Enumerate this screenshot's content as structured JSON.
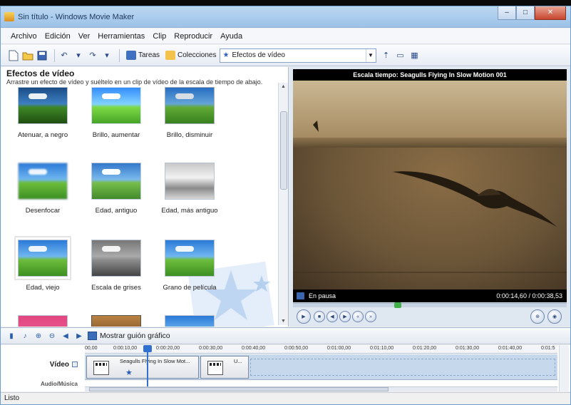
{
  "window": {
    "title": "Sin título - Windows Movie Maker",
    "minimize": "–",
    "maximize": "□",
    "close": "✕"
  },
  "menu": [
    "Archivo",
    "Edición",
    "Ver",
    "Herramientas",
    "Clip",
    "Reproducir",
    "Ayuda"
  ],
  "toolbar": {
    "tasks_label": "Tareas",
    "collections_label": "Colecciones",
    "location_value": "Efectos de vídeo"
  },
  "effects_pane": {
    "title": "Efectos de vídeo",
    "subtitle": "Arrastre un efecto de vídeo y suéltelo en un clip de vídeo de la escala de tiempo de abajo.",
    "items": [
      {
        "label": "Atenuar, a negro"
      },
      {
        "label": "Brillo, aumentar"
      },
      {
        "label": "Brillo, disminuir"
      },
      {
        "label": "Desenfocar"
      },
      {
        "label": "Edad, antiguo"
      },
      {
        "label": "Edad, más antiguo"
      },
      {
        "label": "Edad, viejo"
      },
      {
        "label": "Escala de grises"
      },
      {
        "label": "Grano de película"
      }
    ]
  },
  "preview": {
    "header": "Escala tiempo: Seagulls Flying In Slow Motion 001",
    "status": "En pausa",
    "time": "0:00:14,60 / 0:00:38,53",
    "seek_fraction": 0.38
  },
  "timeline_toolbar": {
    "storyboard_label": "Mostrar guión gráfico"
  },
  "timeline": {
    "ruler_ticks": [
      "00,00",
      "0:00:10,00",
      "0:00:20,00",
      "0:00:30,00",
      "0:00:40,00",
      "0:00:50,00",
      "0:01:00,00",
      "0:01:10,00",
      "0:01:20,00",
      "0:01:30,00",
      "0:01:40,00",
      "0:01:5"
    ],
    "video_label": "Vídeo",
    "audio_label": "Audio/Música",
    "clips": [
      {
        "title": "Seagulls Flying In Slow Mot..."
      },
      {
        "title": "U..."
      }
    ]
  },
  "status_bar": "Listo"
}
